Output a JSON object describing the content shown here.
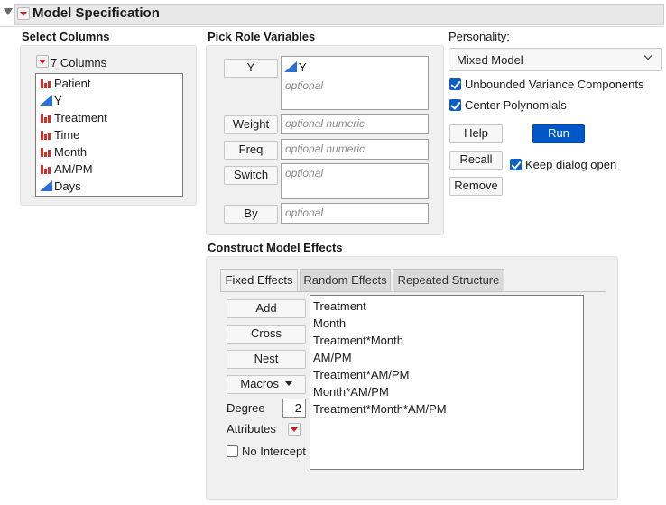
{
  "title": "Model Specification",
  "select_columns": {
    "heading": "Select Columns",
    "count_label": "7 Columns",
    "columns": [
      {
        "name": "Patient",
        "icon": "nominal-bar-icon"
      },
      {
        "name": "Y",
        "icon": "continuous-triangle-icon"
      },
      {
        "name": "Treatment",
        "icon": "nominal-bar-icon"
      },
      {
        "name": "Time",
        "icon": "nominal-bar-icon"
      },
      {
        "name": "Month",
        "icon": "nominal-bar-icon"
      },
      {
        "name": "AM/PM",
        "icon": "nominal-bar-icon"
      },
      {
        "name": "Days",
        "icon": "continuous-triangle-icon"
      }
    ]
  },
  "pick_roles": {
    "heading": "Pick Role Variables",
    "y_button": "Y",
    "y_value": "Y",
    "y_hint": "optional",
    "weight_button": "Weight",
    "weight_hint": "optional numeric",
    "freq_button": "Freq",
    "freq_hint": "optional numeric",
    "switch_button": "Switch",
    "switch_hint": "optional",
    "by_button": "By",
    "by_hint": "optional"
  },
  "personality": {
    "label": "Personality:",
    "selected": "Mixed Model",
    "unbounded_label": "Unbounded Variance Components",
    "unbounded_checked": true,
    "center_label": "Center Polynomials",
    "center_checked": true
  },
  "actions": {
    "help": "Help",
    "run": "Run",
    "recall": "Recall",
    "keep_open_label": "Keep dialog open",
    "keep_open_checked": true,
    "remove": "Remove"
  },
  "effects": {
    "heading": "Construct Model Effects",
    "tabs": [
      "Fixed Effects",
      "Random Effects",
      "Repeated Structure"
    ],
    "active_tab": "Fixed Effects",
    "add": "Add",
    "cross": "Cross",
    "nest": "Nest",
    "macros": "Macros",
    "degree_label": "Degree",
    "degree_value": "2",
    "attributes_label": "Attributes",
    "no_intercept_label": "No Intercept",
    "no_intercept_checked": false,
    "items": [
      "Treatment",
      "Month",
      "Treatment*Month",
      "AM/PM",
      "Treatment*AM/PM",
      "Month*AM/PM",
      "Treatment*Month*AM/PM"
    ]
  },
  "colors": {
    "accent": "#0057c8",
    "nominal_icon": "#d0312d",
    "continuous_icon": "#2a6fd6",
    "red_triangle": "#c81e1e"
  }
}
